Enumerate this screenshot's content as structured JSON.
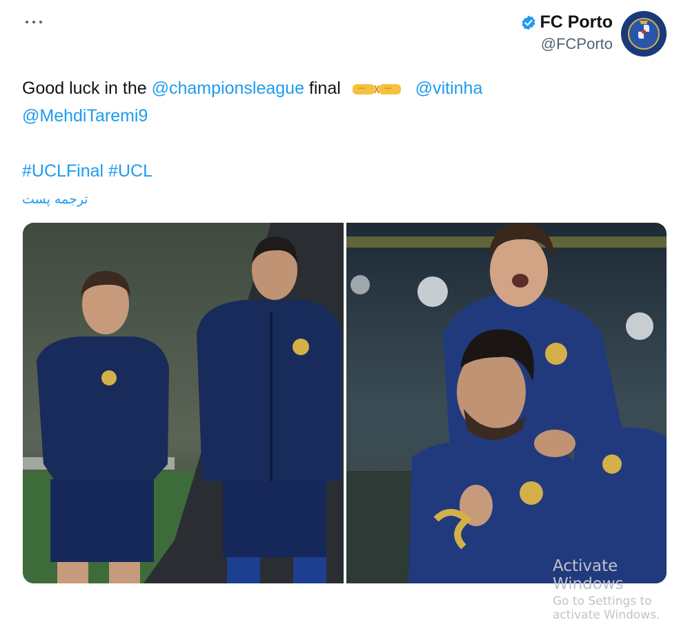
{
  "tweet": {
    "more_icon": "more-horizontal-icon",
    "author": {
      "display_name": "FC Porto",
      "handle": "@FCPorto",
      "verified": true,
      "verified_color": "#1d9bf0",
      "avatar_color": "#1b3a7a"
    },
    "text": {
      "part1": "Good luck in the ",
      "mention_cl": "@championsleague",
      "part2": " final",
      "emoji": "fist-bump-emoji",
      "mention_vitinha": "@vitinha",
      "mention_taremi": "@MehdiTaremi9",
      "hashtag_uclfinal": "#UCLFinal",
      "hashtag_ucl": "#UCL"
    },
    "translate_label": "ترجمه پست",
    "link_color": "#1d9bf0"
  },
  "watermark": {
    "title": "Activate Windows",
    "subtitle": "Go to Settings to activate Windows."
  }
}
